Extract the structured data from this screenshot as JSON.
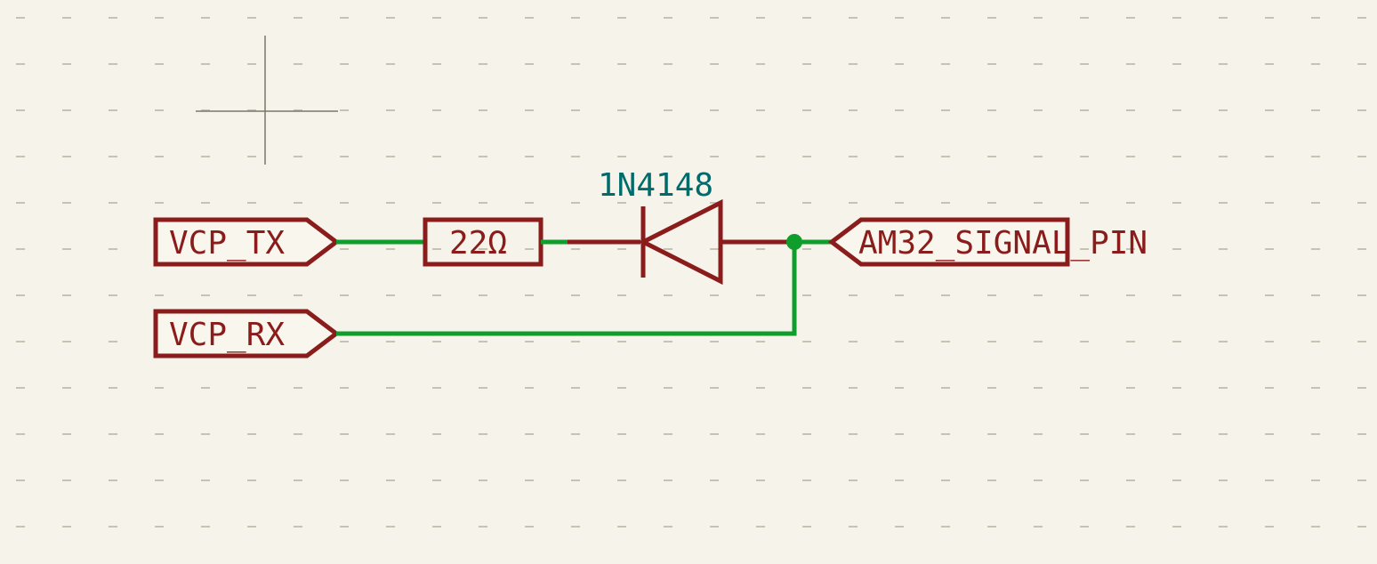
{
  "labels": {
    "tx": "VCP_TX",
    "rx": "VCP_RX",
    "signal": "AM32_SIGNAL_PIN"
  },
  "components": {
    "resistor_value": "22Ω",
    "diode_value": "1N4148"
  },
  "wires": [
    {
      "from": "VCP_TX",
      "to": "R1.1"
    },
    {
      "from": "R1.2",
      "to": "D1.K"
    },
    {
      "from": "D1.A",
      "to": "AM32_SIGNAL_PIN"
    },
    {
      "from": "VCP_RX",
      "to": "junction"
    },
    {
      "from": "junction",
      "to": "AM32_SIGNAL_PIN"
    }
  ],
  "colors": {
    "wire": "#0f9d2b",
    "component": "#8a1c1c",
    "value": "#006b6b",
    "background": "#f6f3eb"
  }
}
